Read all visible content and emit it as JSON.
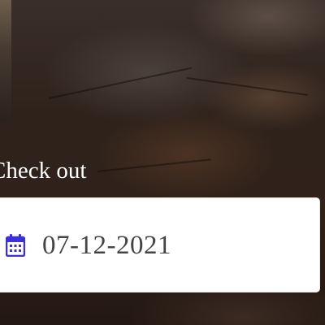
{
  "checkout": {
    "label": "Check out",
    "date_value": "07-12-2021",
    "icon": "calendar-icon"
  },
  "colors": {
    "label_text": "#ffffff",
    "field_background": "#ffffff",
    "value_text": "#444444",
    "icon_accent": "#3b2fe0"
  }
}
